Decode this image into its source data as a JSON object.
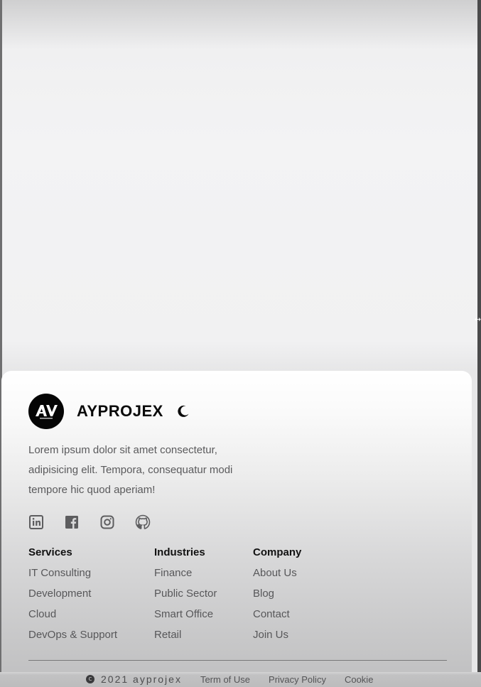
{
  "brand": {
    "name": "AYPROJEX",
    "logo_text": "AY",
    "logo_subtext": "AYPROJEX"
  },
  "description": "Lorem ipsum dolor sit amet consectetur, adipisicing elit. Tempora, consequatur modi tempore hic quod aperiam!",
  "socials": [
    {
      "icon": "linkedin-icon"
    },
    {
      "icon": "facebook-icon"
    },
    {
      "icon": "instagram-icon"
    },
    {
      "icon": "github-icon"
    }
  ],
  "columns": {
    "services": {
      "title": "Services",
      "items": [
        "IT Consulting",
        "Development",
        "Cloud",
        "DevOps & Support"
      ]
    },
    "industries": {
      "title": "Industries",
      "items": [
        "Finance",
        "Public Sector",
        "Smart Office",
        "Retail"
      ]
    },
    "company": {
      "title": "Company",
      "items": [
        "About Us",
        "Blog",
        "Contact",
        "Join Us"
      ]
    }
  },
  "bottom": {
    "copyright_symbol": "c",
    "copyright": "2021 ayprojex",
    "links": [
      "Term of Use",
      "Privacy Policy",
      "Cookie"
    ]
  },
  "colors": {
    "logo_bg": "#050505",
    "text_primary": "#0a0a0a",
    "text_muted": "#575759"
  }
}
